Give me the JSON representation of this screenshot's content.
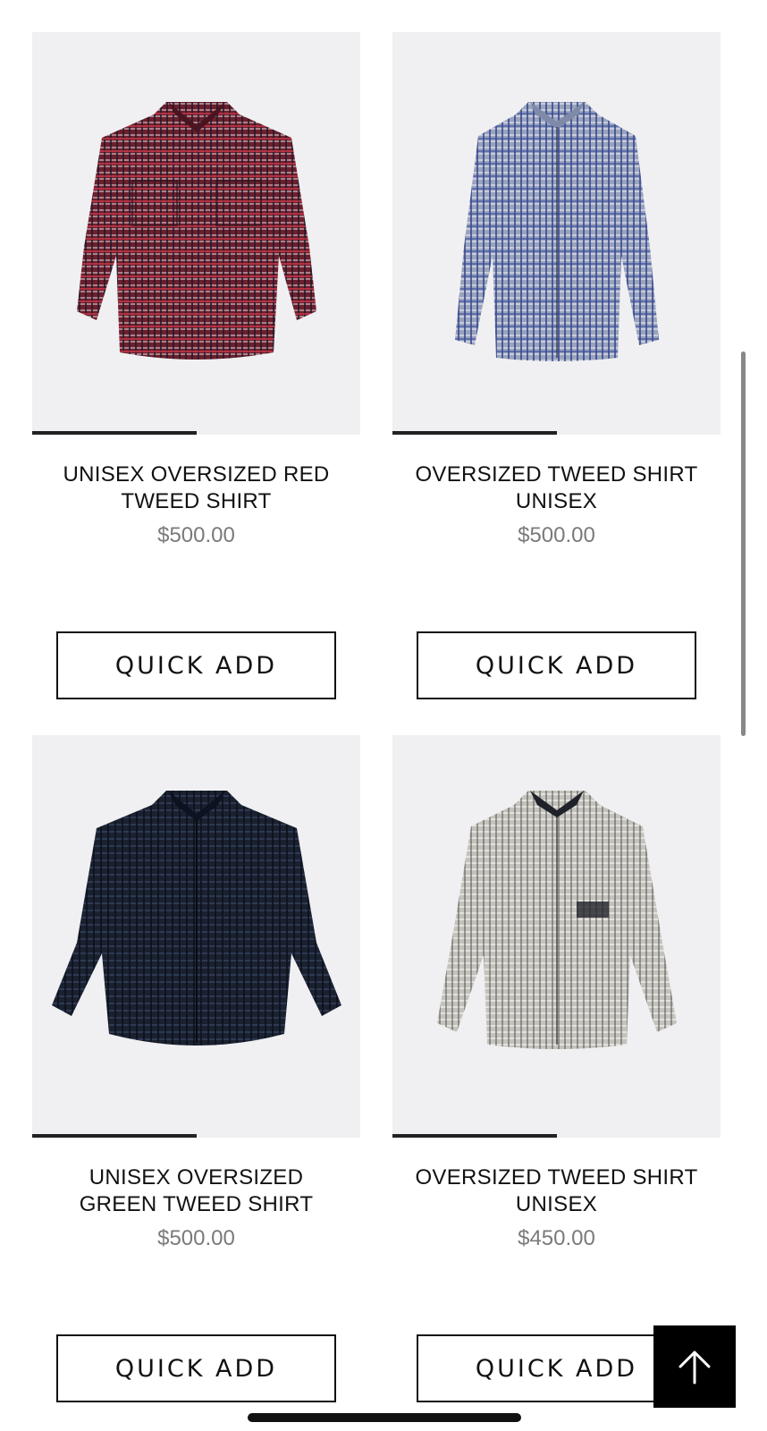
{
  "products": [
    {
      "title": "UNISEX OVERSIZED RED TWEED SHIRT",
      "price": "$500.00",
      "button_label": "QUICK ADD",
      "image_color": "#7a2432",
      "carousel_progress": 0.5
    },
    {
      "title": "OVERSIZED TWEED SHIRT UNISEX",
      "price": "$500.00",
      "button_label": "QUICK ADD",
      "image_color": "#7f8fb0",
      "carousel_progress": 0.5
    },
    {
      "title": "UNISEX OVERSIZED GREEN TWEED SHIRT",
      "price": "$500.00",
      "button_label": "QUICK ADD",
      "image_color": "#1b2230",
      "carousel_progress": 0.5
    },
    {
      "title": "OVERSIZED TWEED SHIRT UNISEX",
      "price": "$450.00",
      "button_label": "QUICK ADD",
      "image_color": "#bdbbb5",
      "carousel_progress": 0.5
    }
  ],
  "back_to_top_icon": "arrow-up-icon"
}
